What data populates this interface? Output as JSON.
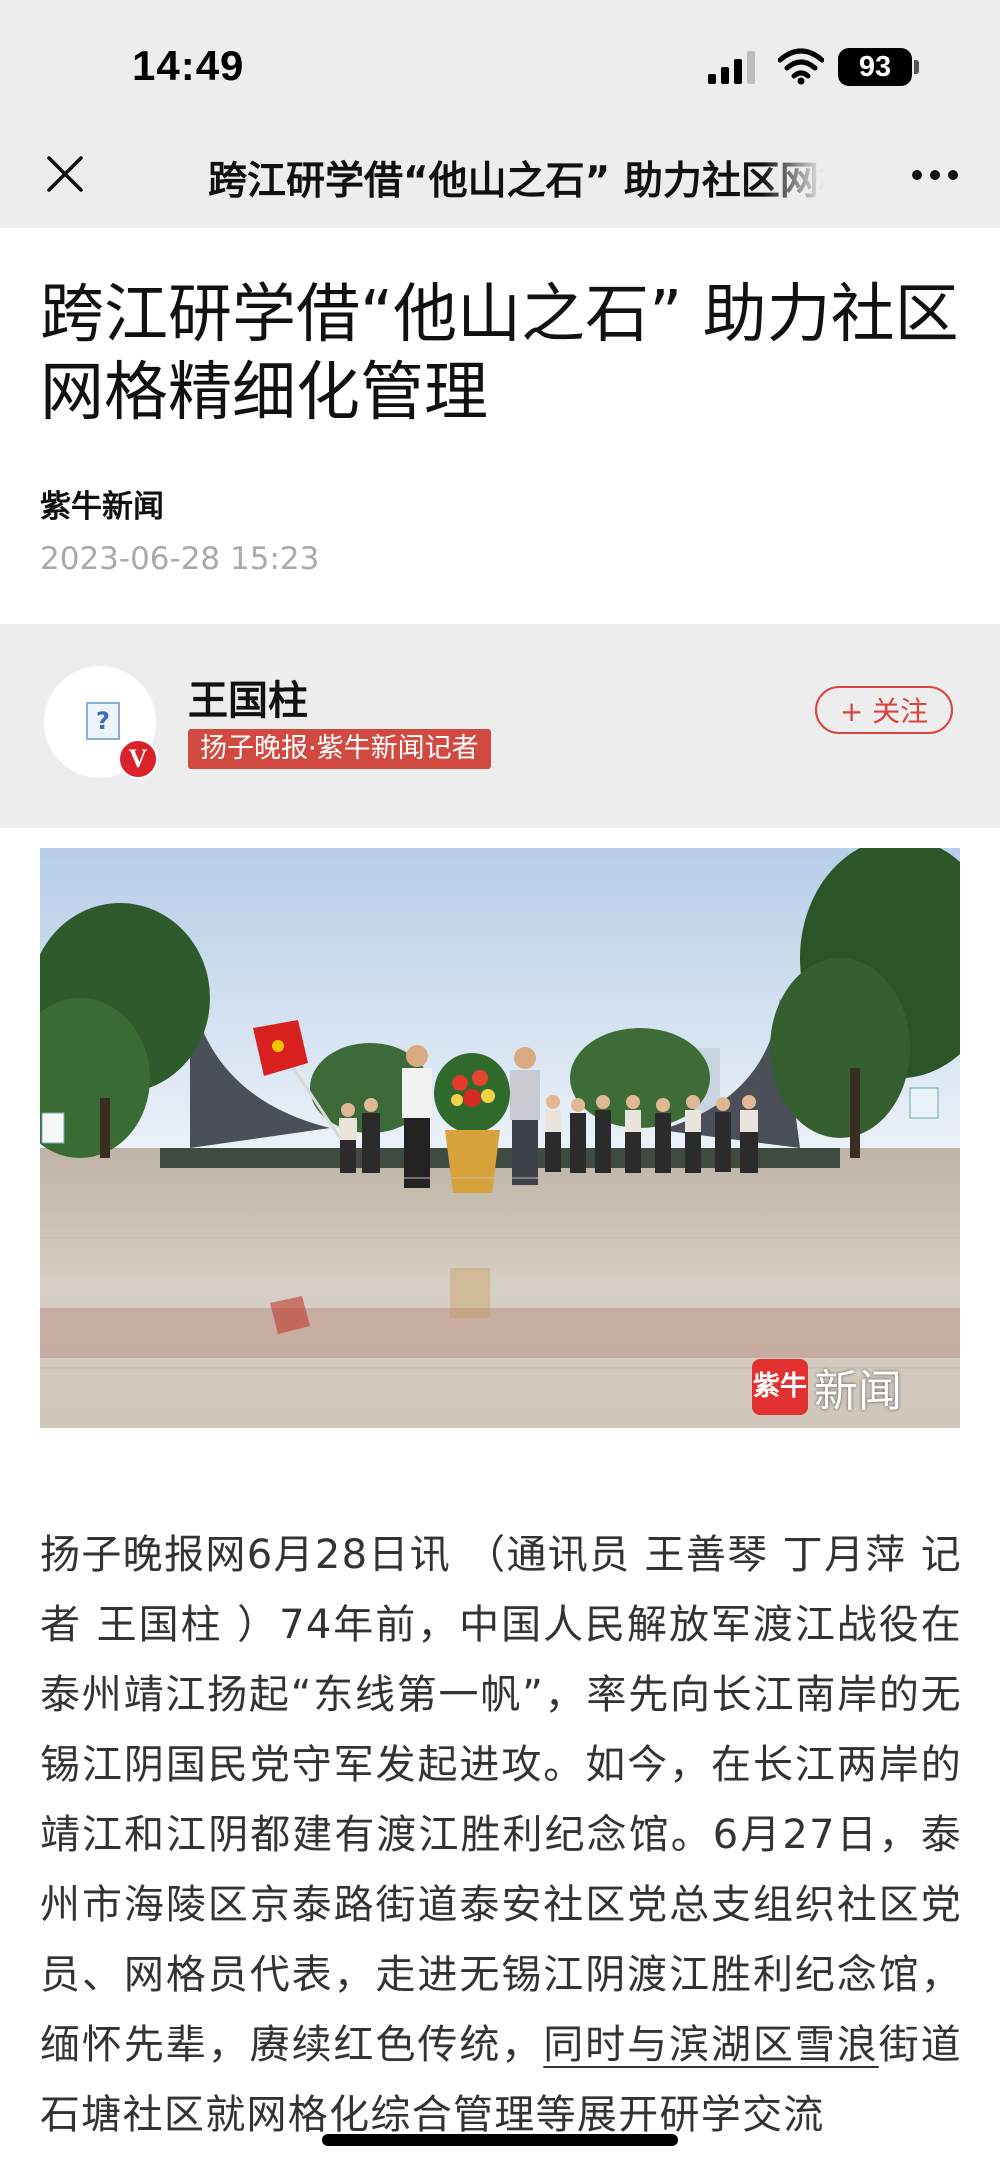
{
  "status_bar": {
    "time": "14:49",
    "battery": "93"
  },
  "nav": {
    "title": "跨江研学借“他山之石” 助力社区网格精细化管理"
  },
  "article": {
    "title": "跨江研学借“他山之石” 助力社区网格精细化管理",
    "source": "紫牛新闻",
    "date": "2023-06-28 15:23"
  },
  "author": {
    "name": "王国柱",
    "tag": "扬子晚报·紫牛新闻记者",
    "follow_label": "+ 关注",
    "badge": "V"
  },
  "photo": {
    "watermark_logo": "紫牛",
    "watermark_text": "新闻"
  },
  "body": {
    "paragraph_main": "扬子晚报网6月28日讯 （通讯员 王善琴 丁月萍 记者 王国柱 ）74年前，中国人民解放军渡江战役在泰州靖江扬起“东线第一帆”，率先向长江南岸的无锡江阴国民党守军发起进攻。如今，在长江两岸的靖江和江阴都建有渡江胜利纪念馆。6月27日，泰州市海陵区京泰路街道泰安社区党总支组织社区党员、网格员代表，走进无锡江阴渡江胜利纪念馆，缅怀先辈，赓续红色传统，",
    "paragraph_underlined": "同时与滨湖区雪浪",
    "paragraph_tail": "街道石塘社区就网格化综合管理等展开研学交流"
  },
  "colors": {
    "accent_red": "#d9443c",
    "bar_gray": "#ededed"
  }
}
